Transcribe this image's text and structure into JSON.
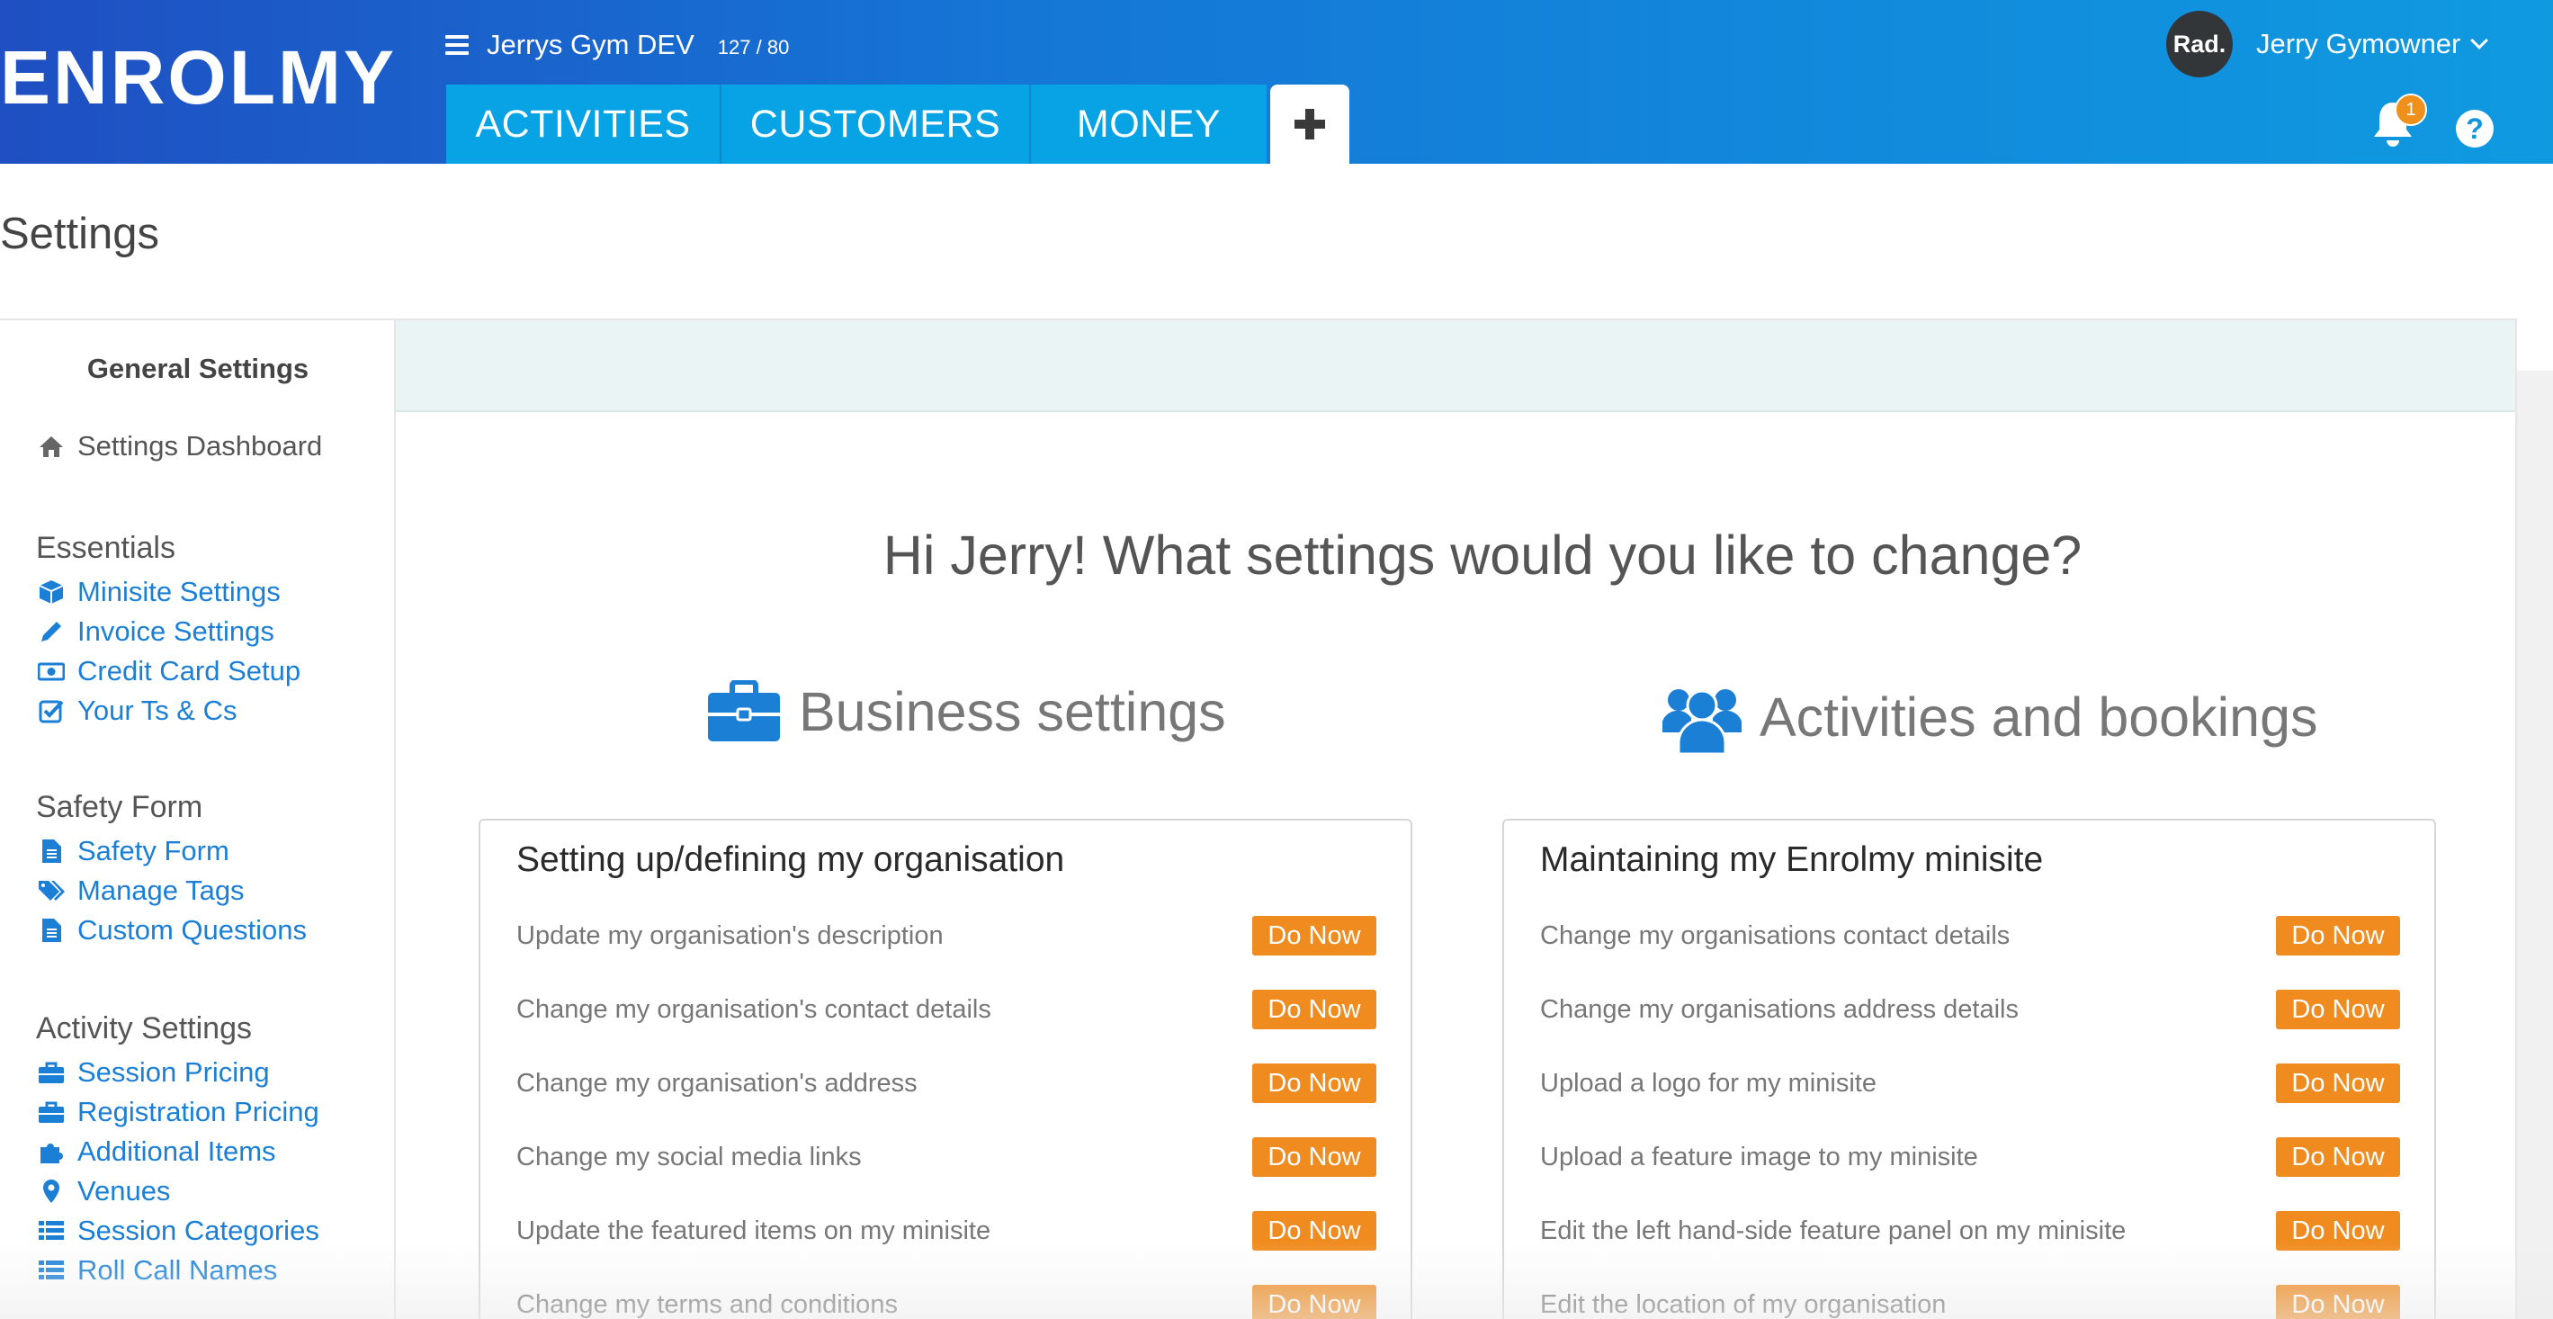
{
  "header": {
    "logo": "ENROLMY",
    "org_name": "Jerrys Gym DEV",
    "org_count": "127 / 80",
    "tabs": [
      {
        "label": "ACTIVITIES"
      },
      {
        "label": "CUSTOMERS"
      },
      {
        "label": "MONEY"
      }
    ],
    "avatar_text": "Rad.",
    "user_name": "Jerry Gymowner",
    "notification_count": "1",
    "help_label": "?",
    "colors": {
      "header_start": "#1f4fc2",
      "header_end": "#0f9ae0",
      "tab": "#07a3e5",
      "badge": "#f0901c"
    }
  },
  "page": {
    "title": "Settings"
  },
  "sidebar": {
    "heading": "General Settings",
    "dashboard": {
      "label": "Settings Dashboard",
      "icon": "home-icon"
    },
    "sections": [
      {
        "title": "Essentials",
        "items": [
          {
            "label": "Minisite Settings",
            "icon": "cube-icon"
          },
          {
            "label": "Invoice Settings",
            "icon": "pencil-icon"
          },
          {
            "label": "Credit Card Setup",
            "icon": "money-icon"
          },
          {
            "label": "Your Ts & Cs",
            "icon": "check-square-icon"
          }
        ]
      },
      {
        "title": "Safety Form",
        "items": [
          {
            "label": "Safety Form",
            "icon": "file-icon"
          },
          {
            "label": "Manage Tags",
            "icon": "tags-icon"
          },
          {
            "label": "Custom Questions",
            "icon": "file-icon"
          }
        ]
      },
      {
        "title": "Activity Settings",
        "items": [
          {
            "label": "Session Pricing",
            "icon": "briefcase-icon"
          },
          {
            "label": "Registration Pricing",
            "icon": "briefcase-icon"
          },
          {
            "label": "Additional Items",
            "icon": "puzzle-icon"
          },
          {
            "label": "Venues",
            "icon": "map-marker-icon"
          },
          {
            "label": "Session Categories",
            "icon": "list-icon"
          },
          {
            "label": "Roll Call Names",
            "icon": "list-icon"
          }
        ]
      }
    ],
    "link_color": "#1b7fd6"
  },
  "main": {
    "greeting": "Hi Jerry! What settings would you like to change?",
    "columns": [
      {
        "title": "Business settings",
        "icon": "briefcase-icon",
        "card_title": "Setting up/defining my organisation",
        "rows": [
          {
            "label": "Update my organisation's description",
            "button": "Do Now"
          },
          {
            "label": "Change my organisation's contact details",
            "button": "Do Now"
          },
          {
            "label": "Change my organisation's address",
            "button": "Do Now"
          },
          {
            "label": "Change my social media links",
            "button": "Do Now"
          },
          {
            "label": "Update the featured items on my minisite",
            "button": "Do Now"
          },
          {
            "label": "Change my terms and conditions",
            "button": "Do Now"
          }
        ]
      },
      {
        "title": "Activities and bookings",
        "icon": "users-icon",
        "card_title": "Maintaining my Enrolmy minisite",
        "rows": [
          {
            "label": "Change my organisations contact details",
            "button": "Do Now"
          },
          {
            "label": "Change my organisations address details",
            "button": "Do Now"
          },
          {
            "label": "Upload a logo for my minisite",
            "button": "Do Now"
          },
          {
            "label": "Upload a feature image to my minisite",
            "button": "Do Now"
          },
          {
            "label": "Edit the left hand-side feature panel on my minisite",
            "button": "Do Now"
          },
          {
            "label": "Edit the location of my organisation",
            "button": "Do Now"
          }
        ]
      }
    ],
    "button_color": "#f08c1f"
  }
}
